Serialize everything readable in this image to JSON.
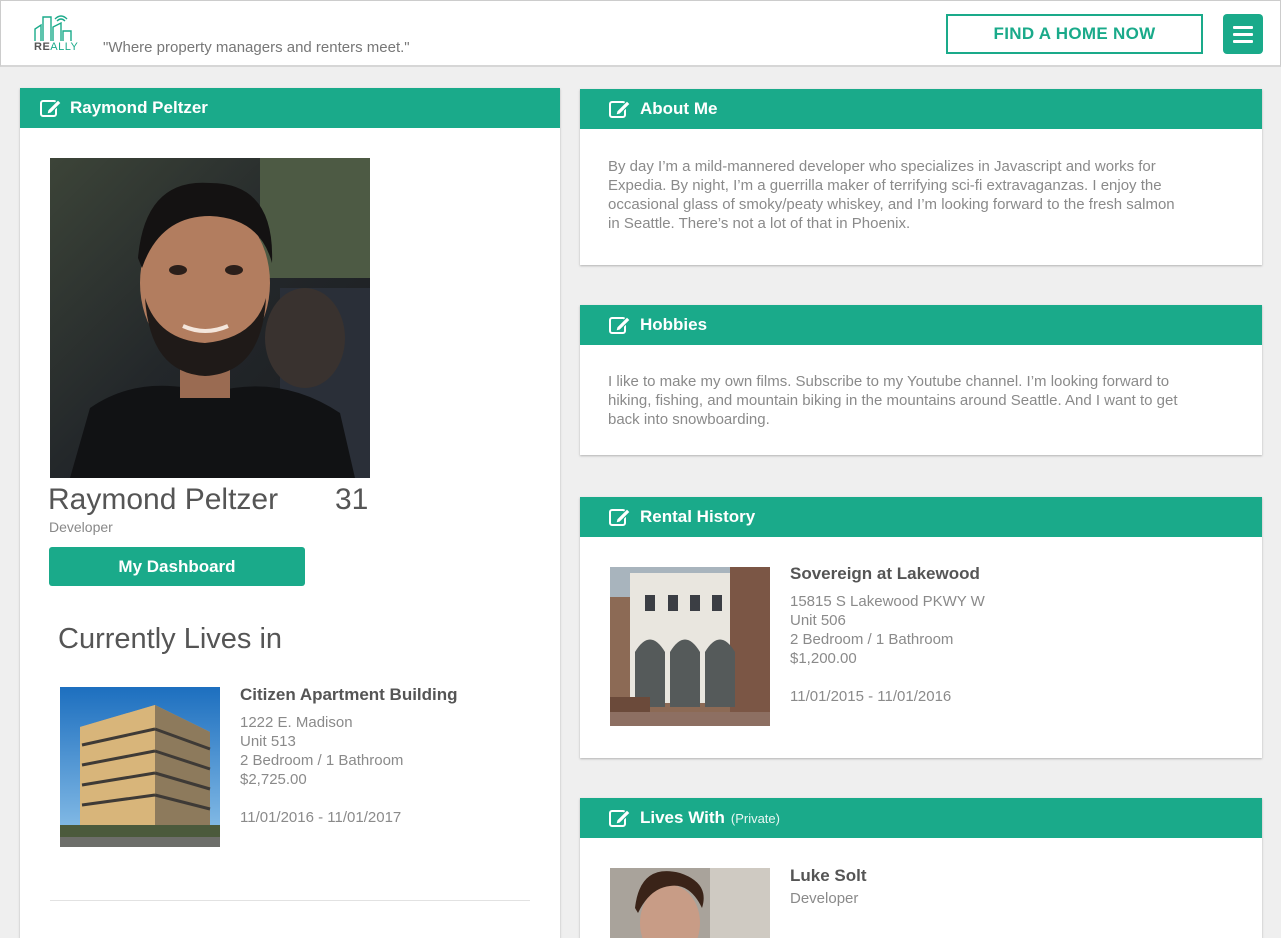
{
  "header": {
    "logo_text_bold": "RE",
    "logo_text_light": "ALLY",
    "tagline": "\"Where property managers and renters meet.\"",
    "find_button": "FIND A HOME NOW",
    "menu_icon": "hamburger-icon",
    "accent_color": "#1aaa8a"
  },
  "profile": {
    "header_title": "Raymond Peltzer",
    "name": "Raymond Peltzer",
    "age": "31",
    "occupation": "Developer",
    "dashboard_button": "My Dashboard",
    "currently_lives_title": "Currently Lives in",
    "current_home": {
      "name": "Citizen Apartment Building",
      "address": "1222 E. Madison",
      "unit": "Unit 513",
      "layout": "2 Bedroom / 1 Bathroom",
      "price": "$2,725.00",
      "dates": "11/01/2016 - 11/01/2017"
    }
  },
  "about": {
    "title": "About Me",
    "lines": [
      "By day I’m a mild-mannered developer who specializes in Javascript and works for",
      "Expedia. By night, I’m a guerrilla maker of terrifying sci-fi extravaganzas. I enjoy the",
      "occasional glass of smoky/peaty whiskey, and I’m looking forward to the fresh salmon",
      "in Seattle. There’s not a lot of that in Phoenix."
    ]
  },
  "hobbies": {
    "title": "Hobbies",
    "lines": [
      "I like to make my own films. Subscribe to my Youtube channel. I’m looking forward to",
      "hiking, fishing, and mountain biking in the mountains around Seattle. And I want to get",
      "back into snowboarding."
    ]
  },
  "rental_history": {
    "title": "Rental History",
    "item": {
      "name": "Sovereign at Lakewood",
      "address": "15815 S Lakewood PKWY W",
      "unit": "Unit 506",
      "layout": "2 Bedroom / 1 Bathroom",
      "price": "$1,200.00",
      "dates": "11/01/2015 - 11/01/2016"
    }
  },
  "lives_with": {
    "title": "Lives With",
    "privacy": "(Private)",
    "person": {
      "name": "Luke Solt",
      "occupation": "Developer"
    }
  }
}
